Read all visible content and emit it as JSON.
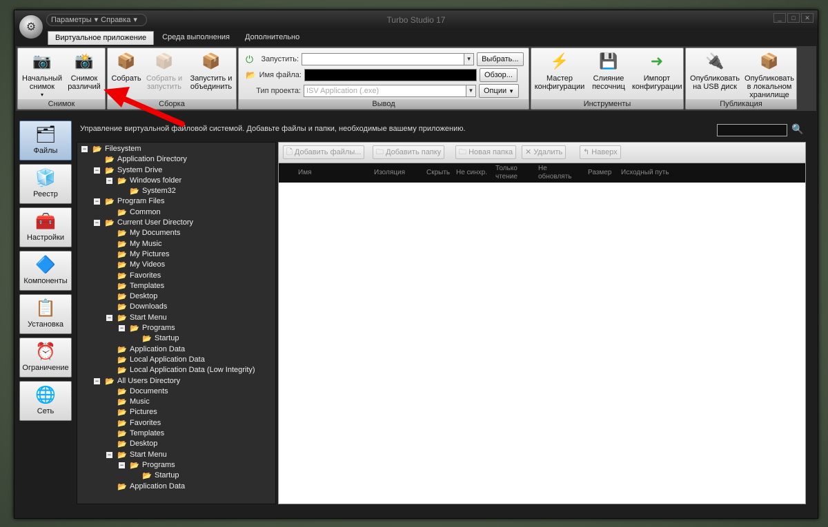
{
  "window": {
    "title": "Turbo Studio 17"
  },
  "quick_access": {
    "params": "Параметры",
    "help": "Справка"
  },
  "tabs": [
    {
      "label": "Виртуальное приложение",
      "active": true
    },
    {
      "label": "Среда выполнения"
    },
    {
      "label": "Дополнительно"
    }
  ],
  "ribbon": {
    "snapshot": {
      "label": "Снимок",
      "initial": "Начальный снимок",
      "diff": "Снимок различий"
    },
    "build": {
      "label": "Сборка",
      "build": "Собрать",
      "build_run": "Собрать и запустить",
      "run_merge": "Запустить и объединить"
    },
    "output": {
      "label": "Вывод",
      "run_label": "Запустить:",
      "file_label": "Имя файла:",
      "type_label": "Тип проекта:",
      "type_value": "ISV Application (.exe)",
      "select_btn": "Выбрать...",
      "browse_btn": "Обзор...",
      "options_btn": "Опции"
    },
    "tools": {
      "label": "Инструменты",
      "wizard": "Мастер конфигурации",
      "merge": "Слияние песочниц",
      "import": "Импорт конфигурации"
    },
    "publish": {
      "label": "Публикация",
      "usb": "Опубликовать на USB диск",
      "local": "Опубликовать в локальном хранилище"
    }
  },
  "nav": [
    "Файлы",
    "Реестр",
    "Настройки",
    "Компоненты",
    "Установка",
    "Ограничение",
    "Сеть"
  ],
  "description": "Управление виртуальной файловой системой. Добавьте файлы и папки, необходимые вашему приложению.",
  "tree": [
    {
      "label": "Filesystem",
      "level": 0,
      "toggle": "−"
    },
    {
      "label": "Application Directory",
      "level": 1
    },
    {
      "label": "System Drive",
      "level": 1,
      "toggle": "−"
    },
    {
      "label": "Windows folder",
      "level": 2,
      "toggle": "−"
    },
    {
      "label": "System32",
      "level": 3
    },
    {
      "label": "Program Files",
      "level": 1,
      "toggle": "−"
    },
    {
      "label": "Common",
      "level": 2
    },
    {
      "label": "Current User Directory",
      "level": 1,
      "toggle": "−"
    },
    {
      "label": "My Documents",
      "level": 2
    },
    {
      "label": "My Music",
      "level": 2
    },
    {
      "label": "My Pictures",
      "level": 2
    },
    {
      "label": "My Videos",
      "level": 2
    },
    {
      "label": "Favorites",
      "level": 2
    },
    {
      "label": "Templates",
      "level": 2
    },
    {
      "label": "Desktop",
      "level": 2
    },
    {
      "label": "Downloads",
      "level": 2
    },
    {
      "label": "Start Menu",
      "level": 2,
      "toggle": "−"
    },
    {
      "label": "Programs",
      "level": 3,
      "toggle": "−"
    },
    {
      "label": "Startup",
      "level": 4
    },
    {
      "label": "Application Data",
      "level": 2
    },
    {
      "label": "Local Application Data",
      "level": 2
    },
    {
      "label": "Local Application Data (Low Integrity)",
      "level": 2
    },
    {
      "label": "All Users Directory",
      "level": 1,
      "toggle": "−"
    },
    {
      "label": "Documents",
      "level": 2
    },
    {
      "label": "Music",
      "level": 2
    },
    {
      "label": "Pictures",
      "level": 2
    },
    {
      "label": "Favorites",
      "level": 2
    },
    {
      "label": "Templates",
      "level": 2
    },
    {
      "label": "Desktop",
      "level": 2
    },
    {
      "label": "Start Menu",
      "level": 2,
      "toggle": "−"
    },
    {
      "label": "Programs",
      "level": 3,
      "toggle": "−"
    },
    {
      "label": "Startup",
      "level": 4
    },
    {
      "label": "Application Data",
      "level": 2
    }
  ],
  "file_toolbar": [
    "Добавить файлы...",
    "Добавить папку",
    "Новая папка",
    "Удалить",
    "Наверх"
  ],
  "columns": [
    "Имя",
    "Изоляция",
    "Скрыть",
    "Не синхр.",
    "Только чтение",
    "Не обновлять",
    "Размер",
    "Исходный путь"
  ]
}
